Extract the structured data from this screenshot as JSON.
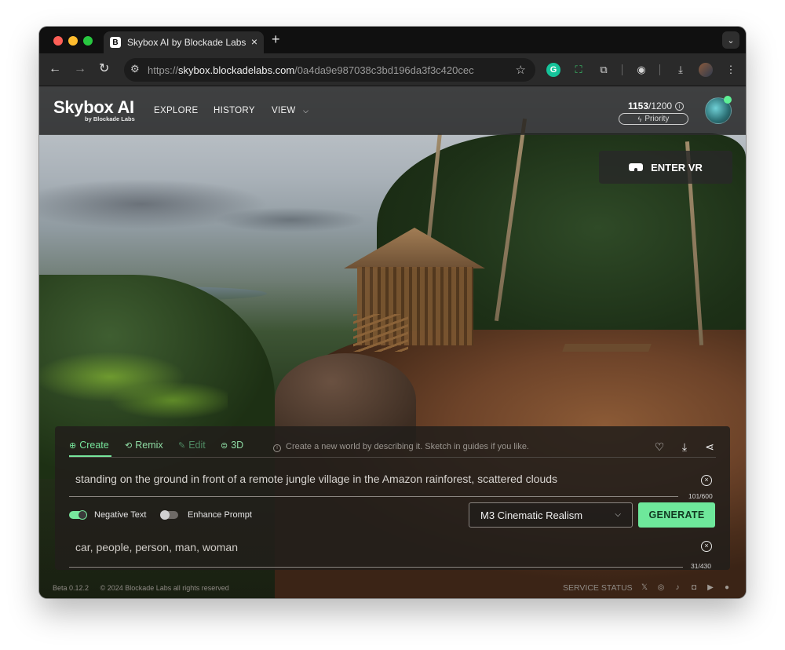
{
  "browser": {
    "tab_title": "Skybox AI by Blockade Labs",
    "tab_favicon": "B",
    "url_scheme": "https://",
    "url_host": "skybox.blockadelabs.com",
    "url_path": "/0a4da9e987038c3bd196da3f3c420cec",
    "icons": [
      "back-icon",
      "forward-icon",
      "reload-icon",
      "site-settings-icon",
      "star-icon",
      "grammarly-icon",
      "screenshot-icon",
      "extensions-icon",
      "lens-icon",
      "download-icon",
      "profile-avatar",
      "menu-icon"
    ]
  },
  "app": {
    "logo": "Skybox AI",
    "logo_sub": "by Blockade Labs",
    "nav": {
      "explore": "EXPLORE",
      "history": "HISTORY",
      "view": "VIEW"
    },
    "credits_used": "1153",
    "credits_total": "/1200",
    "priority_label": "Priority",
    "enter_vr": "ENTER VR"
  },
  "panel": {
    "tabs": {
      "create": "Create",
      "remix": "Remix",
      "edit": "Edit",
      "threed": "3D"
    },
    "hint": "Create a new world by describing it. Sketch in guides if you like.",
    "prompt": "standing on the ground in front of a remote jungle village in the Amazon rainforest, scattered clouds",
    "prompt_counter": "101/600",
    "negative_text_label": "Negative Text",
    "enhance_prompt_label": "Enhance Prompt",
    "negative_text_enabled": true,
    "enhance_prompt_enabled": false,
    "style_value": "M3 Cinematic Realism",
    "generate_label": "GENERATE",
    "negative_prompt": "car, people, person, man, woman",
    "negative_counter": "31/430"
  },
  "footer": {
    "version": "Beta 0.12.2",
    "copyright": "© 2024 Blockade Labs all rights reserved",
    "service_status": "SERVICE STATUS",
    "social_icons": [
      "x-icon",
      "instagram-icon",
      "tiktok-icon",
      "discord-icon",
      "youtube-icon",
      "reddit-icon"
    ]
  },
  "colors": {
    "accent": "#6ee89b",
    "tab_green": "#77e69c"
  }
}
